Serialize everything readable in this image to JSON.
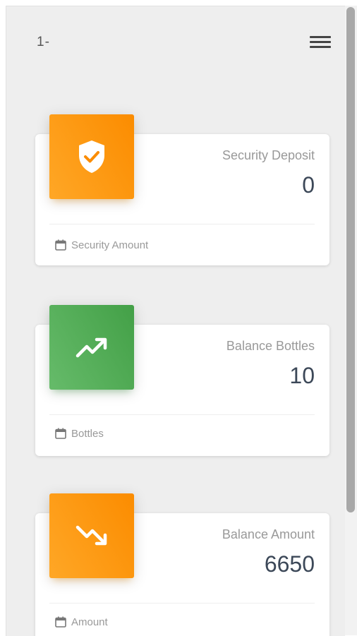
{
  "header": {
    "title": "1-",
    "menu_icon": "hamburger-menu-icon"
  },
  "cards": [
    {
      "icon": "shield-check-icon",
      "color": "#fb8c00",
      "category": "Security Deposit",
      "value": "0",
      "footer_icon": "calendar-icon",
      "footer": "Security Amount"
    },
    {
      "icon": "trending-up-icon",
      "color": "#43a047",
      "category": "Balance Bottles",
      "value": "10",
      "footer_icon": "calendar-icon",
      "footer": "Bottles"
    },
    {
      "icon": "trending-down-icon",
      "color": "#fb8c00",
      "category": "Balance Amount",
      "value": "6650",
      "footer_icon": "calendar-icon",
      "footer": "Amount"
    }
  ]
}
